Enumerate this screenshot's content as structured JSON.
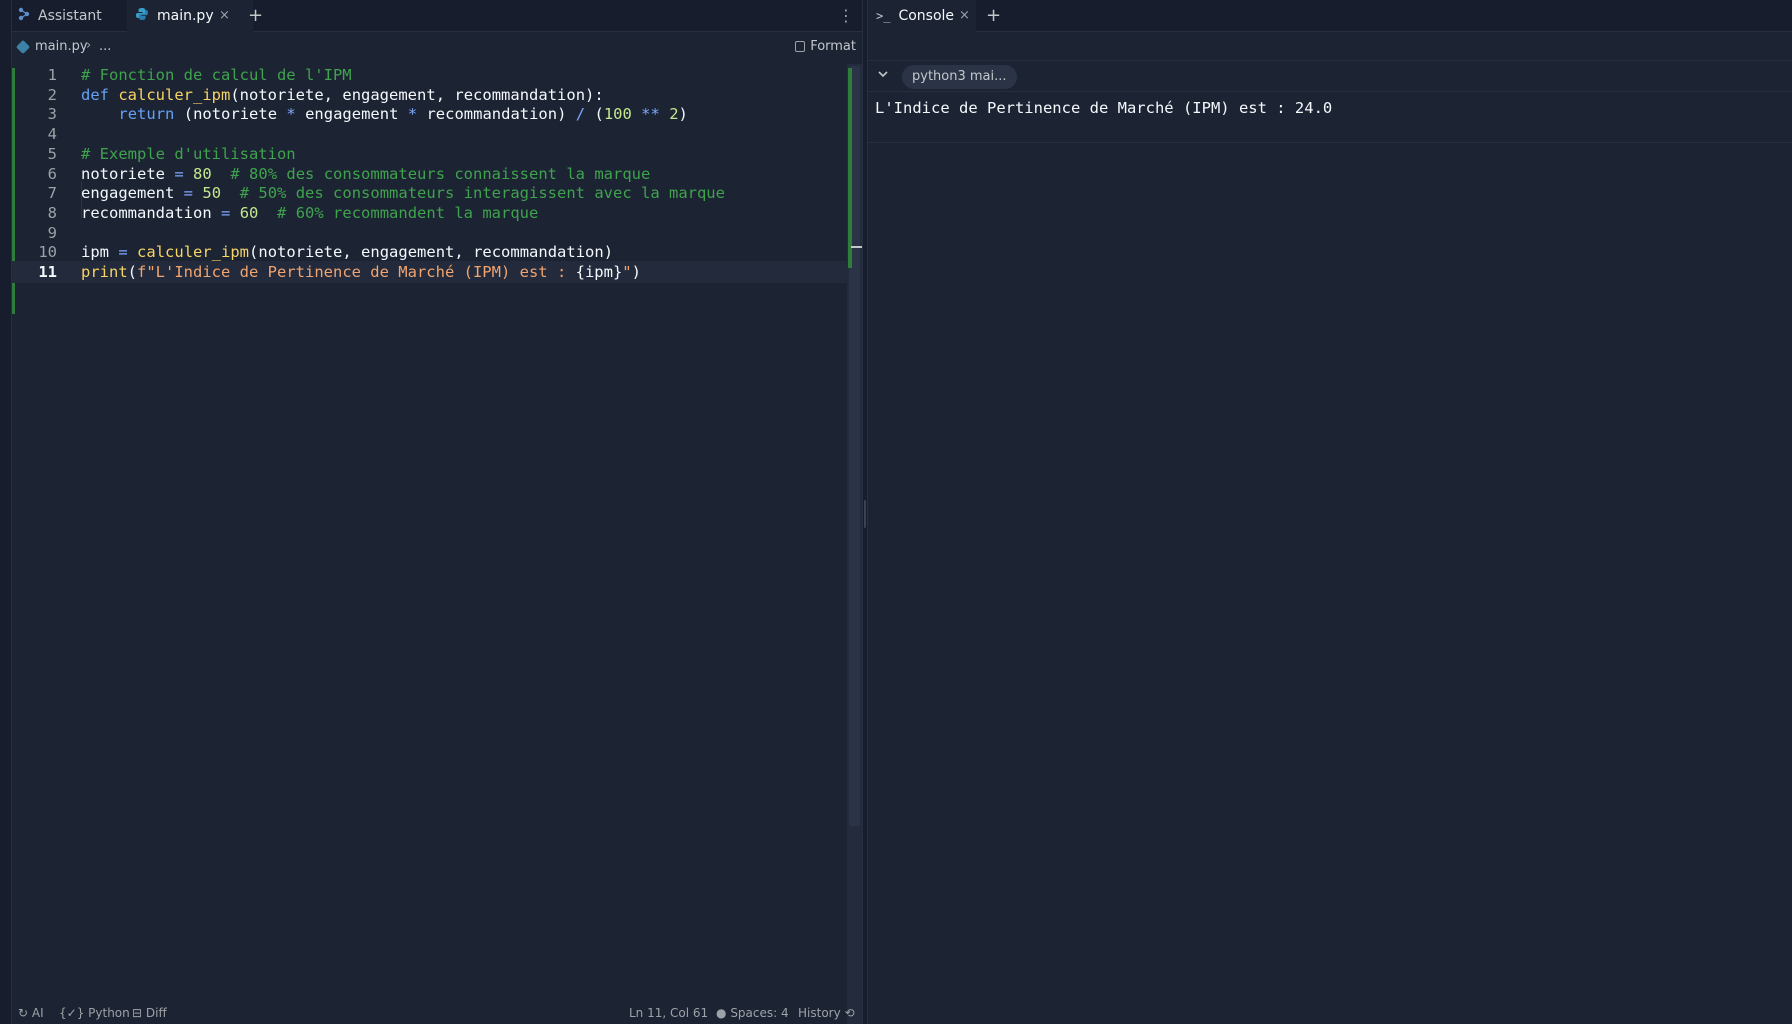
{
  "editor": {
    "tabs": [
      {
        "label": "Assistant",
        "icon": "assistant-icon"
      },
      {
        "label": "main.py",
        "icon": "python-file-icon",
        "close": "×"
      }
    ],
    "add_tab": "+",
    "menu": "⋮",
    "breadcrumb": {
      "file": "main.py",
      "separator": "›",
      "more": "..."
    },
    "format_label": "Format",
    "code_lines": [
      {
        "n": "1",
        "text": "# Fonction de calcul de l'IPM"
      },
      {
        "n": "2",
        "text": "def calculer_ipm(notoriete, engagement, recommandation):"
      },
      {
        "n": "3",
        "text": "    return (notoriete * engagement * recommandation) / (100 ** 2)"
      },
      {
        "n": "4",
        "text": ""
      },
      {
        "n": "5",
        "text": "# Exemple d'utilisation"
      },
      {
        "n": "6",
        "text": "notoriete = 80  # 80% des consommateurs connaissent la marque"
      },
      {
        "n": "7",
        "text": "engagement = 50  # 50% des consommateurs interagissent avec la marque"
      },
      {
        "n": "8",
        "text": "recommandation = 60  # 60% recommandent la marque"
      },
      {
        "n": "9",
        "text": ""
      },
      {
        "n": "10",
        "text": "ipm = calculer_ipm(notoriete, engagement, recommandation)"
      },
      {
        "n": "11",
        "text": "print(f\"L'Indice de Pertinence de Marché (IPM) est : {ipm}\")"
      }
    ],
    "current_line": "11"
  },
  "statusbar": {
    "ai": "AI",
    "language": "Python",
    "diff": "Diff",
    "cursor": "Ln 11, Col 61",
    "spaces": "Spaces: 4",
    "history": "History"
  },
  "console": {
    "tab_label": "Console",
    "tab_icon": "terminal-prompt-icon",
    "tab_close": "×",
    "add_tab": "+",
    "session_label": "python3 mai...",
    "output": "L'Indice de Pertinence de Marché (IPM) est : 24.0"
  },
  "colors": {
    "background": "#1c2333",
    "tabbar": "#171d2d",
    "comment": "#3fa34d",
    "keyword": "#64a2f5",
    "function": "#f6d465",
    "number": "#c3e88d",
    "string": "#f0a470",
    "change_marker": "#2f7d3a"
  }
}
